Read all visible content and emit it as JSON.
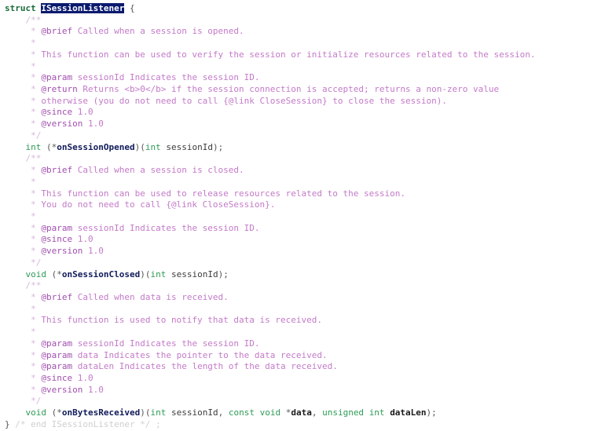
{
  "editor": {
    "language": "c",
    "background": "#ffffff",
    "selection_color": "#0a1a6e",
    "comment_color": "#c37ac8",
    "keyword_color": "#2e9b57",
    "function_color": "#101b5a",
    "selected_token": "ISessionListener"
  },
  "code": {
    "lines": [
      {
        "id": 1,
        "indent": 0,
        "tokens": [
          {
            "t": "struct ",
            "c": "kw"
          },
          {
            "t": "ISessionListener",
            "c": "sel"
          },
          {
            "t": " {",
            "c": "punct"
          }
        ]
      },
      {
        "id": 2,
        "indent": 4,
        "tokens": [
          {
            "t": "/**",
            "c": "cmlite"
          }
        ]
      },
      {
        "id": 3,
        "indent": 5,
        "tokens": [
          {
            "t": "* ",
            "c": "cmlite"
          },
          {
            "t": "@brief",
            "c": "cmtag"
          },
          {
            "t": " Called when a session is opened.",
            "c": "cm"
          }
        ]
      },
      {
        "id": 4,
        "indent": 5,
        "tokens": [
          {
            "t": "*",
            "c": "cmlite"
          }
        ]
      },
      {
        "id": 5,
        "indent": 5,
        "tokens": [
          {
            "t": "* ",
            "c": "cmlite"
          },
          {
            "t": "This function can be used to verify the session or initialize resources related to the session.",
            "c": "cm"
          }
        ]
      },
      {
        "id": 6,
        "indent": 5,
        "tokens": [
          {
            "t": "*",
            "c": "cmlite"
          }
        ]
      },
      {
        "id": 7,
        "indent": 5,
        "tokens": [
          {
            "t": "* ",
            "c": "cmlite"
          },
          {
            "t": "@param",
            "c": "cmtag"
          },
          {
            "t": " sessionId Indicates the session ID.",
            "c": "cm"
          }
        ]
      },
      {
        "id": 8,
        "indent": 5,
        "tokens": [
          {
            "t": "* ",
            "c": "cmlite"
          },
          {
            "t": "@return",
            "c": "cmtag"
          },
          {
            "t": " Returns <b>0</b> if the session connection is accepted; returns a non-zero value",
            "c": "cm"
          }
        ]
      },
      {
        "id": 9,
        "indent": 5,
        "tokens": [
          {
            "t": "* ",
            "c": "cmlite"
          },
          {
            "t": "otherwise (you do not need to call {@link CloseSession} to close the session).",
            "c": "cm"
          }
        ]
      },
      {
        "id": 10,
        "indent": 5,
        "tokens": [
          {
            "t": "* ",
            "c": "cmlite"
          },
          {
            "t": "@since",
            "c": "cmtag"
          },
          {
            "t": " 1.0",
            "c": "cm"
          }
        ]
      },
      {
        "id": 11,
        "indent": 5,
        "tokens": [
          {
            "t": "* ",
            "c": "cmlite"
          },
          {
            "t": "@version",
            "c": "cmtag"
          },
          {
            "t": " 1.0",
            "c": "cm"
          }
        ]
      },
      {
        "id": 12,
        "indent": 5,
        "tokens": [
          {
            "t": "*/",
            "c": "cmlite"
          }
        ]
      },
      {
        "id": 13,
        "indent": 4,
        "tokens": [
          {
            "t": "int",
            "c": "type"
          },
          {
            "t": " (*",
            "c": "punct"
          },
          {
            "t": "onSessionOpened",
            "c": "fn"
          },
          {
            "t": ")(",
            "c": "punct"
          },
          {
            "t": "int",
            "c": "type"
          },
          {
            "t": " ",
            "c": "punct"
          },
          {
            "t": "sessionId",
            "c": "ident"
          },
          {
            "t": ");",
            "c": "punct"
          }
        ]
      },
      {
        "id": 14,
        "indent": 4,
        "tokens": [
          {
            "t": "/**",
            "c": "cmlite"
          }
        ]
      },
      {
        "id": 15,
        "indent": 5,
        "tokens": [
          {
            "t": "* ",
            "c": "cmlite"
          },
          {
            "t": "@brief",
            "c": "cmtag"
          },
          {
            "t": " Called when a session is closed.",
            "c": "cm"
          }
        ]
      },
      {
        "id": 16,
        "indent": 5,
        "tokens": [
          {
            "t": "*",
            "c": "cmlite"
          }
        ]
      },
      {
        "id": 17,
        "indent": 5,
        "tokens": [
          {
            "t": "* ",
            "c": "cmlite"
          },
          {
            "t": "This function can be used to release resources related to the session.",
            "c": "cm"
          }
        ]
      },
      {
        "id": 18,
        "indent": 5,
        "tokens": [
          {
            "t": "* ",
            "c": "cmlite"
          },
          {
            "t": "You do not need to call {@link CloseSession}.",
            "c": "cm"
          }
        ]
      },
      {
        "id": 19,
        "indent": 5,
        "tokens": [
          {
            "t": "*",
            "c": "cmlite"
          }
        ]
      },
      {
        "id": 20,
        "indent": 5,
        "tokens": [
          {
            "t": "* ",
            "c": "cmlite"
          },
          {
            "t": "@param",
            "c": "cmtag"
          },
          {
            "t": " sessionId Indicates the session ID.",
            "c": "cm"
          }
        ]
      },
      {
        "id": 21,
        "indent": 5,
        "tokens": [
          {
            "t": "* ",
            "c": "cmlite"
          },
          {
            "t": "@since",
            "c": "cmtag"
          },
          {
            "t": " 1.0",
            "c": "cm"
          }
        ]
      },
      {
        "id": 22,
        "indent": 5,
        "tokens": [
          {
            "t": "* ",
            "c": "cmlite"
          },
          {
            "t": "@version",
            "c": "cmtag"
          },
          {
            "t": " 1.0",
            "c": "cm"
          }
        ]
      },
      {
        "id": 23,
        "indent": 5,
        "tokens": [
          {
            "t": "*/",
            "c": "cmlite"
          }
        ]
      },
      {
        "id": 24,
        "indent": 4,
        "tokens": [
          {
            "t": "void",
            "c": "type"
          },
          {
            "t": " (*",
            "c": "punct"
          },
          {
            "t": "onSessionClosed",
            "c": "fn"
          },
          {
            "t": ")(",
            "c": "punct"
          },
          {
            "t": "int",
            "c": "type"
          },
          {
            "t": " ",
            "c": "punct"
          },
          {
            "t": "sessionId",
            "c": "ident"
          },
          {
            "t": ");",
            "c": "punct"
          }
        ]
      },
      {
        "id": 25,
        "indent": 4,
        "tokens": [
          {
            "t": "/**",
            "c": "cmlite"
          }
        ]
      },
      {
        "id": 26,
        "indent": 5,
        "tokens": [
          {
            "t": "* ",
            "c": "cmlite"
          },
          {
            "t": "@brief",
            "c": "cmtag"
          },
          {
            "t": " Called when data is received.",
            "c": "cm"
          }
        ]
      },
      {
        "id": 27,
        "indent": 5,
        "tokens": [
          {
            "t": "*",
            "c": "cmlite"
          }
        ]
      },
      {
        "id": 28,
        "indent": 5,
        "tokens": [
          {
            "t": "* ",
            "c": "cmlite"
          },
          {
            "t": "This function is used to notify that data is received.",
            "c": "cm"
          }
        ]
      },
      {
        "id": 29,
        "indent": 5,
        "tokens": [
          {
            "t": "*",
            "c": "cmlite"
          }
        ]
      },
      {
        "id": 30,
        "indent": 5,
        "tokens": [
          {
            "t": "* ",
            "c": "cmlite"
          },
          {
            "t": "@param",
            "c": "cmtag"
          },
          {
            "t": " sessionId Indicates the session ID.",
            "c": "cm"
          }
        ]
      },
      {
        "id": 31,
        "indent": 5,
        "tokens": [
          {
            "t": "* ",
            "c": "cmlite"
          },
          {
            "t": "@param",
            "c": "cmtag"
          },
          {
            "t": " data Indicates the pointer to the data received.",
            "c": "cm"
          }
        ]
      },
      {
        "id": 32,
        "indent": 5,
        "tokens": [
          {
            "t": "* ",
            "c": "cmlite"
          },
          {
            "t": "@param",
            "c": "cmtag"
          },
          {
            "t": " dataLen Indicates the length of the data received.",
            "c": "cm"
          }
        ]
      },
      {
        "id": 33,
        "indent": 5,
        "tokens": [
          {
            "t": "* ",
            "c": "cmlite"
          },
          {
            "t": "@since",
            "c": "cmtag"
          },
          {
            "t": " 1.0",
            "c": "cm"
          }
        ]
      },
      {
        "id": 34,
        "indent": 5,
        "tokens": [
          {
            "t": "* ",
            "c": "cmlite"
          },
          {
            "t": "@version",
            "c": "cmtag"
          },
          {
            "t": " 1.0",
            "c": "cm"
          }
        ]
      },
      {
        "id": 35,
        "indent": 5,
        "tokens": [
          {
            "t": "*/",
            "c": "cmlite"
          }
        ]
      },
      {
        "id": 36,
        "indent": 4,
        "tokens": [
          {
            "t": "void",
            "c": "type"
          },
          {
            "t": " (*",
            "c": "punct"
          },
          {
            "t": "onBytesReceived",
            "c": "fn"
          },
          {
            "t": ")(",
            "c": "punct"
          },
          {
            "t": "int",
            "c": "type"
          },
          {
            "t": " ",
            "c": "punct"
          },
          {
            "t": "sessionId",
            "c": "ident"
          },
          {
            "t": ", ",
            "c": "punct"
          },
          {
            "t": "const",
            "c": "type"
          },
          {
            "t": " ",
            "c": "punct"
          },
          {
            "t": "void",
            "c": "type"
          },
          {
            "t": " *",
            "c": "punct"
          },
          {
            "t": "data",
            "c": "identb"
          },
          {
            "t": ", ",
            "c": "punct"
          },
          {
            "t": "unsigned",
            "c": "type"
          },
          {
            "t": " ",
            "c": "punct"
          },
          {
            "t": "int",
            "c": "type"
          },
          {
            "t": " ",
            "c": "punct"
          },
          {
            "t": "dataLen",
            "c": "identb"
          },
          {
            "t": ");",
            "c": "punct"
          }
        ]
      },
      {
        "id": 37,
        "indent": 0,
        "tokens": [
          {
            "t": "}",
            "c": "punct"
          },
          {
            "t": " /* end ISessionListener */ ",
            "c": "trail"
          },
          {
            "t": ";",
            "c": "trail"
          }
        ]
      }
    ]
  }
}
